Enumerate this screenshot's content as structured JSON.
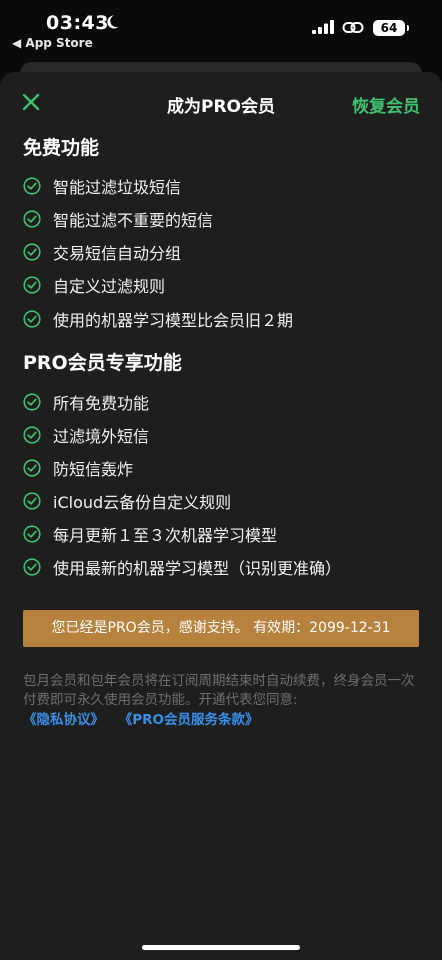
{
  "status_bar": {
    "time": "03:43",
    "back_app": "◀ App Store",
    "battery": "64"
  },
  "nav": {
    "title": "成为PRO会员",
    "restore": "恢复会员"
  },
  "free_section": {
    "title": "免费功能",
    "items": [
      "智能过滤垃圾短信",
      "智能过滤不重要的短信",
      "交易短信自动分组",
      "自定义过滤规则",
      "使用的机器学习模型比会员旧２期"
    ]
  },
  "pro_section": {
    "title": "PRO会员专享功能",
    "items": [
      "所有免费功能",
      "过滤境外短信",
      "防短信轰炸",
      "iCloud云备份自定义规则",
      "每月更新１至３次机器学习模型",
      "使用最新的机器学习模型（识别更准确）"
    ]
  },
  "banner": {
    "text": "您已经是PRO会员，感谢支持。 有效期：2099-12-31"
  },
  "notice": {
    "text": "包月会员和包年会员将在订阅周期结束时自动续费，终身会员一次付费即可永久使用会员功能。开通代表您同意:",
    "privacy_link": "《隐私协议》",
    "terms_link": "《PRO会员服务条款》"
  },
  "colors": {
    "accent": "#3ec16c",
    "banner": "#b7823d",
    "link": "#3a8fe8"
  }
}
